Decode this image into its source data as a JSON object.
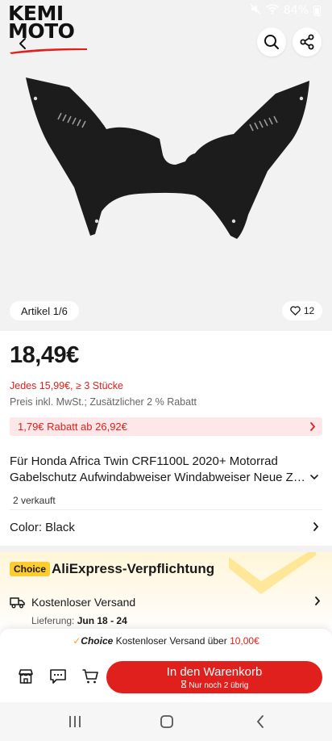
{
  "status": {
    "battery": "84%"
  },
  "brand": {
    "line1": "KEMI",
    "line2": "MOTO"
  },
  "gallery": {
    "article_counter": "Artikel 1/6",
    "wishlist_count": "12"
  },
  "product": {
    "price": "18,49€",
    "bulk_price": "Jedes 15,99€, ≥ 3 Stücke",
    "tax_note": "Preis inkl. MwSt.; Zusätzlicher 2 % Rabatt",
    "coupon": "1,79€ Rabatt ab 26,92€",
    "title_line1": "Für Honda Africa Twin CRF1100L 2020+ Motorrad",
    "title_line2": "Gabelschutz Aufwindabweiser Windabweiser Neue Zubehör",
    "sold": "2 verkauft",
    "color_label": "Color: Black"
  },
  "choice": {
    "badge": "Choice",
    "title": "AliExpress-Verpflichtung",
    "shipping": "Kostenloser Versand",
    "delivery_label": "Lieferung: ",
    "delivery_dates": "Jun 18 - 24"
  },
  "bottom": {
    "promo_choice": "Choice",
    "promo_text": " Kostenloser Versand über ",
    "promo_price": "10,00€",
    "add_to_cart": "In den Warenkorb",
    "stock_note": "Nur noch 2 übrig"
  },
  "colors": {
    "accent": "#e0201d",
    "choice_yellow": "#ffcc2d",
    "background_gray": "#f2f2f2"
  },
  "icons": [
    "back-icon",
    "search-icon",
    "share-icon",
    "heart-icon",
    "chevron-right-icon",
    "chevron-down-icon",
    "truck-icon",
    "store-icon",
    "chat-icon",
    "cart-icon",
    "hourglass-icon",
    "recent-apps-icon",
    "home-icon",
    "back-nav-icon"
  ]
}
